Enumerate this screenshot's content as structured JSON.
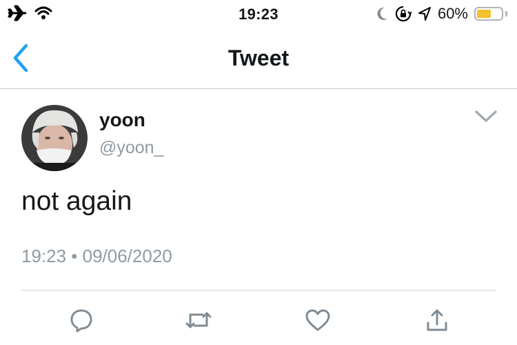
{
  "status_bar": {
    "time": "19:23",
    "battery_percent": "60%",
    "battery_level": 0.6,
    "icons": [
      "airplane-icon",
      "wifi-icon",
      "moon-icon",
      "rotation-lock-icon",
      "location-icon",
      "battery-icon"
    ]
  },
  "nav": {
    "title": "Tweet",
    "back_icon": "chevron-left-icon"
  },
  "tweet": {
    "display_name": "yoon",
    "handle": "@yoon_",
    "text": "not again",
    "timestamp": "19:23 • 09/06/2020",
    "menu_icon": "chevron-down-icon"
  },
  "actions": [
    "reply-icon",
    "retweet-icon",
    "like-icon",
    "share-icon"
  ],
  "colors": {
    "accent": "#1da1f2",
    "secondary_text": "#8f9aa3",
    "battery": "#f2c12e",
    "icon_gray": "#7f8b94"
  }
}
